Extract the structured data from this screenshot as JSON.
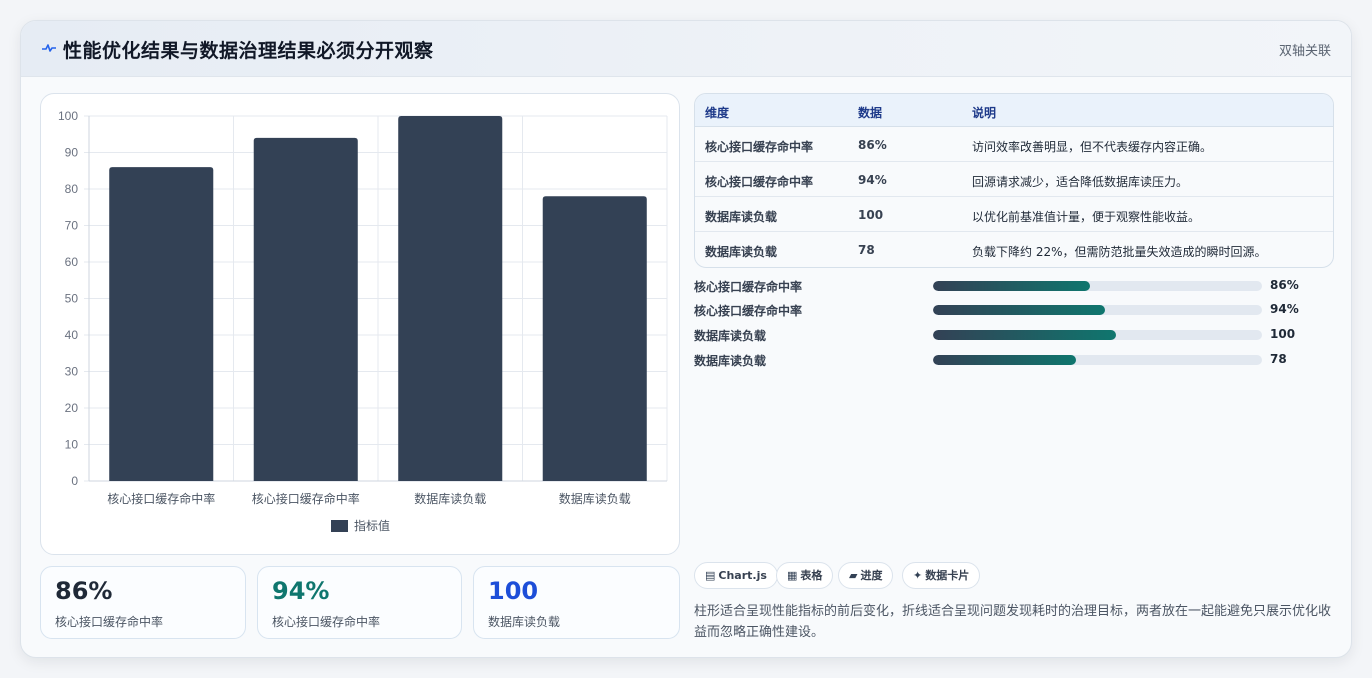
{
  "header": {
    "title": "性能优化结果与数据治理结果必须分开观察",
    "tag": "双轴关联"
  },
  "chart_data": {
    "type": "bar",
    "categories": [
      "核心接口缓存命中率",
      "核心接口缓存命中率",
      "数据库读负载",
      "数据库读负载"
    ],
    "series": [
      {
        "name": "指标值",
        "values": [
          86,
          94,
          100,
          78
        ],
        "color": "#334155"
      }
    ],
    "ylim": [
      0,
      100
    ],
    "yticks": [
      "0",
      "10",
      "20",
      "30",
      "40",
      "50",
      "60",
      "70",
      "80",
      "90",
      "100"
    ],
    "grid": true,
    "legend": "bottom"
  },
  "stats": [
    {
      "value": "86%",
      "label": "核心接口缓存命中率",
      "color": "#1f2937"
    },
    {
      "value": "94%",
      "label": "核心接口缓存命中率",
      "color": "#0f766e"
    },
    {
      "value": "100",
      "label": "数据库读负载",
      "color": "#1d4ed8"
    }
  ],
  "table": {
    "headers": [
      "维度",
      "数据",
      "说明"
    ],
    "rows": [
      [
        "核心接口缓存命中率",
        "86%",
        "访问效率改善明显，但不代表缓存内容正确。"
      ],
      [
        "核心接口缓存命中率",
        "94%",
        "回源请求减少，适合降低数据库读压力。"
      ],
      [
        "数据库读负载",
        "100",
        "以优化前基准值计量，便于观察性能收益。"
      ],
      [
        "数据库读负载",
        "78",
        "负载下降约 22%，但需防范批量失效造成的瞬时回源。"
      ]
    ]
  },
  "progress": [
    {
      "label": "核心接口缓存命中率",
      "value": "86%",
      "fraction": 0.476
    },
    {
      "label": "核心接口缓存命中率",
      "value": "94%",
      "fraction": 0.522
    },
    {
      "label": "数据库读负载",
      "value": "100",
      "fraction": 0.556
    },
    {
      "label": "数据库读负载",
      "value": "78",
      "fraction": 0.434
    }
  ],
  "chips": [
    {
      "icon": "▤",
      "label": "Chart.js"
    },
    {
      "icon": "▦",
      "label": "表格"
    },
    {
      "icon": "▰",
      "label": "进度"
    },
    {
      "icon": "✦",
      "label": "数据卡片"
    }
  ],
  "description": "柱形适合呈现性能指标的前后变化，折线适合呈现问题发现耗时的治理目标，两者放在一起能避免只展示优化收益而忽略正确性建设。"
}
